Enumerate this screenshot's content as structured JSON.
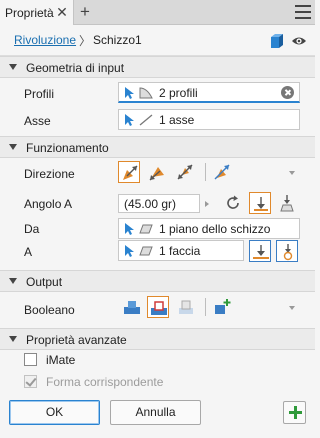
{
  "tab": {
    "label": "Proprietà",
    "icons": [
      "close-icon",
      "add-icon",
      "menu-icon"
    ]
  },
  "breadcrumb": {
    "link": "Rivoluzione",
    "separator": "〉",
    "current": "Schizzo1"
  },
  "colors": {
    "accent": "#2a83d0",
    "link": "#1a6fb0",
    "orange": "#e0892c",
    "green": "#2f9a3a"
  },
  "sections": {
    "input": {
      "title": "Geometria di input",
      "profiles_label": "Profili",
      "profiles_value": "2 profili",
      "axis_label": "Asse",
      "axis_value": "1 asse"
    },
    "behavior": {
      "title": "Funzionamento",
      "direction_label": "Direzione",
      "angle_label": "Angolo A",
      "angle_value": "(45.00 gr)",
      "from_label": "Da",
      "from_value": "1 piano dello schizzo",
      "to_label": "A",
      "to_value": "1 faccia"
    },
    "output": {
      "title": "Output",
      "boolean_label": "Booleano"
    },
    "advanced": {
      "title": "Proprietà avanzate",
      "imate_label": "iMate",
      "imate_checked": false,
      "match_shape_label": "Forma corrispondente",
      "match_shape_checked": true,
      "match_shape_enabled": false
    }
  },
  "footer": {
    "ok_label": "OK",
    "cancel_label": "Annulla"
  }
}
